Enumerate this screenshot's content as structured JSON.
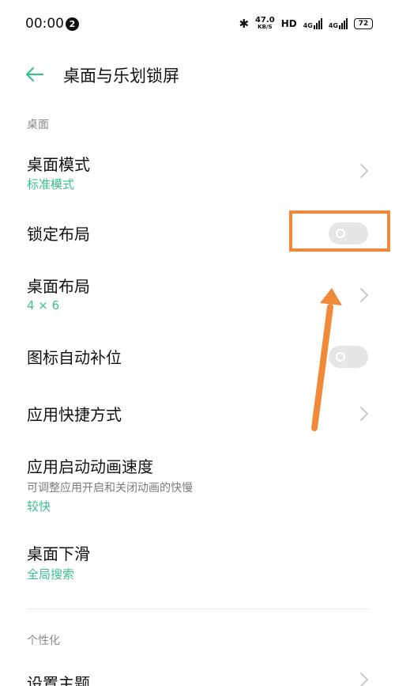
{
  "status_bar": {
    "time": "00:00",
    "notification_count": "2",
    "bluetooth_icon": "bluetooth-icon",
    "net_speed": "47.0",
    "net_speed_unit": "KB/S",
    "hd_label": "HD",
    "signal1_label": "4G",
    "signal2_label": "4G",
    "battery": "72"
  },
  "header": {
    "back_icon": "arrow-left-icon",
    "title": "桌面与乐划锁屏"
  },
  "sections": {
    "desktop_label": "桌面",
    "personalize_label": "个性化"
  },
  "rows": {
    "desktop_mode": {
      "title": "桌面模式",
      "value": "标准模式"
    },
    "lock_layout": {
      "title": "锁定布局",
      "toggle_on": false
    },
    "desktop_layout": {
      "title": "桌面布局",
      "value": "4 × 6"
    },
    "icon_autofill": {
      "title": "图标自动补位",
      "toggle_on": false
    },
    "app_shortcuts": {
      "title": "应用快捷方式"
    },
    "app_anim_speed": {
      "title": "应用启动动画速度",
      "description": "可调整应用开启和关闭动画的快慢",
      "value": "较快"
    },
    "swipe_down": {
      "title": "桌面下滑",
      "value": "全局搜索"
    },
    "set_theme": {
      "title": "设置主题"
    }
  },
  "colors": {
    "accent": "#3bbf8f",
    "annotation": "#f0893a",
    "toggle_off": "#e6e6e6"
  }
}
